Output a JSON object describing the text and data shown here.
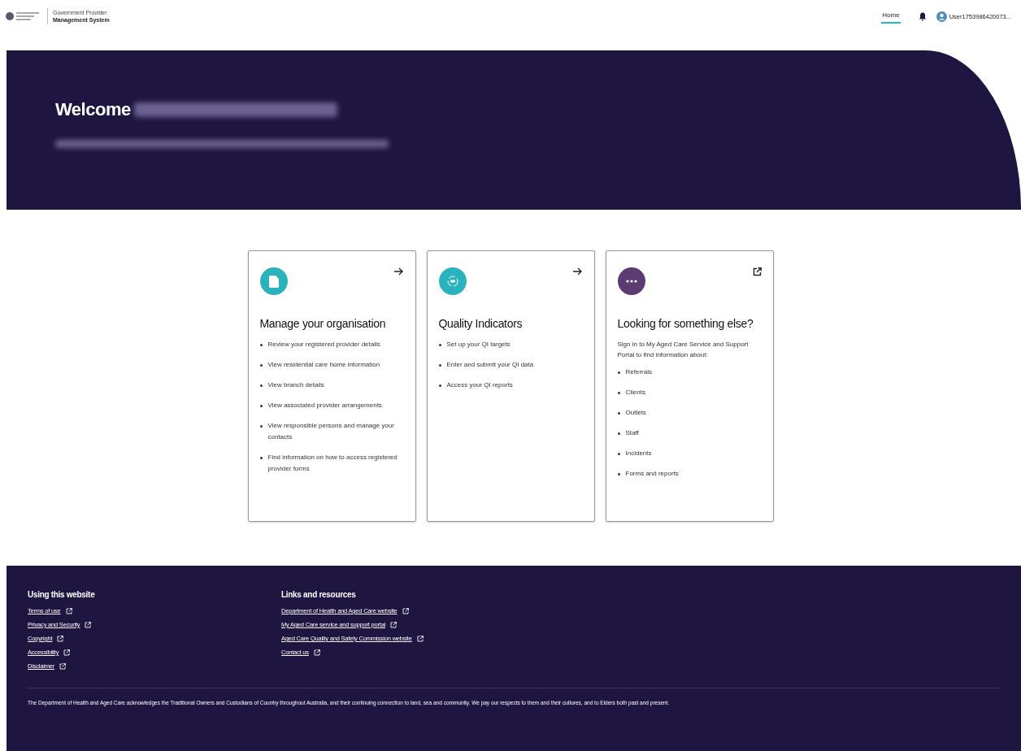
{
  "header": {
    "logo_line1": "Government Provider",
    "logo_line2": "Management System",
    "nav": [
      {
        "label": "Home",
        "selected": true
      }
    ],
    "user": "User1753986420073..."
  },
  "hero": {
    "greeting": "Welcome"
  },
  "cards": [
    {
      "kind": "internal",
      "color": "#2ab3bd",
      "title": "Manage your organisation",
      "items": [
        "Review your registered provider details",
        "View residential care home information",
        "View branch details",
        "View associated provider arrangements",
        "View responsible persons and manage your contacts",
        "Find information on how to access registered provider forms"
      ]
    },
    {
      "kind": "internal",
      "color": "#2ab3bd",
      "title": "Quality Indicators",
      "items": [
        "Set up your QI targets",
        "Enter and submit your QI data",
        "Access your QI reports"
      ]
    },
    {
      "kind": "external",
      "color": "#5c3a72",
      "title": "Looking for something else?",
      "intro": "Sign in to My Aged Care Service and Support Portal to find information about:",
      "items": [
        "Referrals",
        "Clients",
        "Outlets",
        "Staff",
        "Incidents",
        "Forms and reports"
      ]
    }
  ],
  "footer": {
    "columns": [
      {
        "heading": "Using this website",
        "links": [
          "Terms of use",
          "Privacy and Security",
          "Copyright",
          "Accessibility",
          "Disclaimer"
        ]
      },
      {
        "heading": "Links and resources",
        "links": [
          "Department of Health and Aged Care website",
          "My Aged Care service and support portal",
          "Aged Care Quality and Safety Commission website",
          "Contact us"
        ]
      }
    ],
    "acknowledgement": "The Department of Health and Aged Care acknowledges the Traditional Owners and Custodians of Country throughout Australia, and their continuing connection to land, sea and community. We pay our respects to them and their cultures, and to Elders both past and present."
  }
}
